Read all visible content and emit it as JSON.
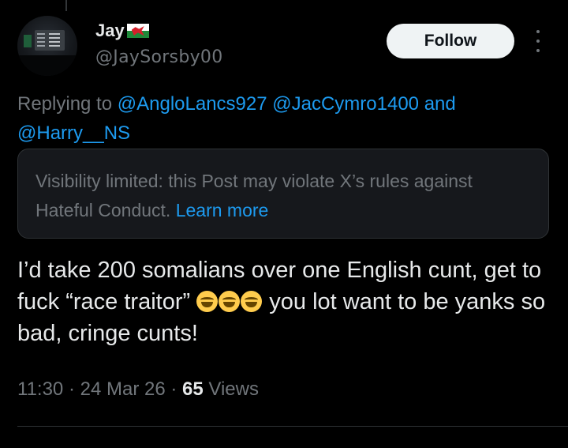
{
  "user": {
    "name": "Jay",
    "handle": "@JaySorsby00",
    "flag_icon": "wales-flag-icon"
  },
  "follow_button": {
    "label": "Follow"
  },
  "more_icon": "more-vertical-icon",
  "replying": {
    "prefix": "Replying to",
    "mention1": "@AngloLancs927",
    "mention2": "@JacCymro1400",
    "conjunction": "and",
    "mention3": "@Harry__NS"
  },
  "notice": {
    "text": "Visibility limited: this Post may violate X’s rules against Hateful Conduct.",
    "link": "Learn more"
  },
  "tweet": {
    "part1": "I’d take 200 somalians over one English cunt, get to fuck “race traitor” ",
    "emoji_name": "rolling-on-the-floor-laughing-icon",
    "part2": " you lot want to be yanks so bad, cringe cunts!"
  },
  "meta": {
    "time": "11:30",
    "sep1": " · ",
    "date": "24 Mar 26",
    "sep2": " · ",
    "views_count": "65",
    "views_label": " Views"
  },
  "colors": {
    "background": "#000000",
    "text": "#e7e9ea",
    "secondary": "#71767b",
    "link": "#1d9bf0",
    "button_bg": "#eff3f4"
  }
}
